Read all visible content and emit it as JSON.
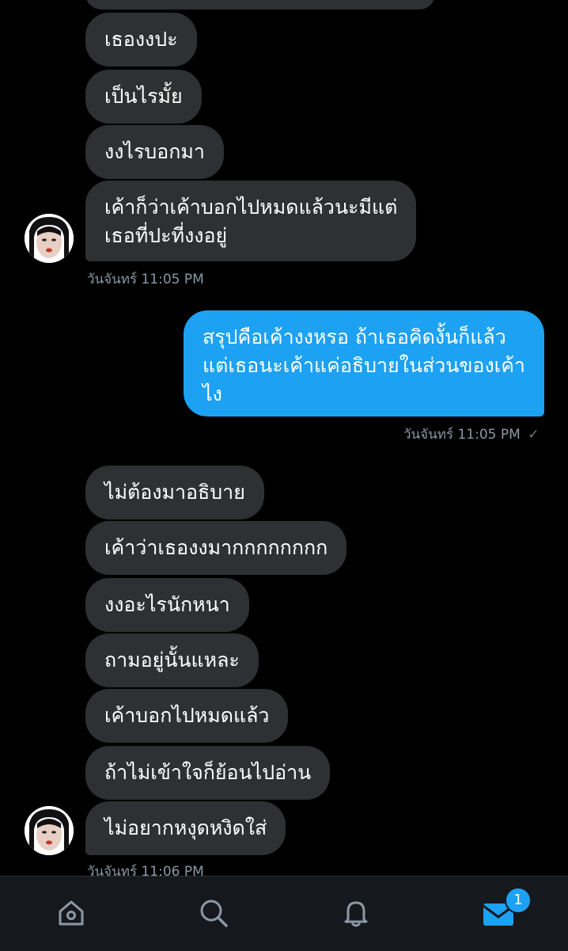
{
  "messages_first_group": [
    "เธองงปะ",
    "เป็นไรมั้ย",
    "งงไรบอกมา",
    "เค้าก็ว่าเค้าบอกไปหมดแล้วนะมีแต่\nเธอที่ปะที่งงอยู่"
  ],
  "timestamp_first_group": "วันจันทร์ 11:05 PM",
  "sent_message": "สรุปคือเค้างงหรอ ถ้าเธอคิดงั้นก็แล้ว\nแต่เธอนะเค้าแค่อธิบายในส่วนของเค้า\nไง",
  "timestamp_sent": "วันจันทร์ 11:05 PM",
  "messages_second_group": [
    "ไม่ต้องมาอธิบาย",
    "เค้าว่าเธองงมากกกกกกกก",
    "งงอะไรนักหนา",
    "ถามอยู่นั้นแหละ",
    "เค้าบอกไปหมดแล้ว",
    "ถ้าไม่เข้าใจก็ย้อนไปอ่าน",
    "ไม่อยากหงุดหงิดใส่"
  ],
  "timestamp_second_group": "วันจันทร์ 11:06 PM",
  "tabbar": {
    "home": "home-icon",
    "search": "search-icon",
    "notifications": "bell-icon",
    "messages": "mail-icon",
    "messages_badge": "1"
  },
  "colors": {
    "background": "#000000",
    "received_bubble": "#2f3033",
    "sent_bubble": "#1da1f2",
    "timestamp": "#8b98a5",
    "accent": "#1da1f2"
  }
}
